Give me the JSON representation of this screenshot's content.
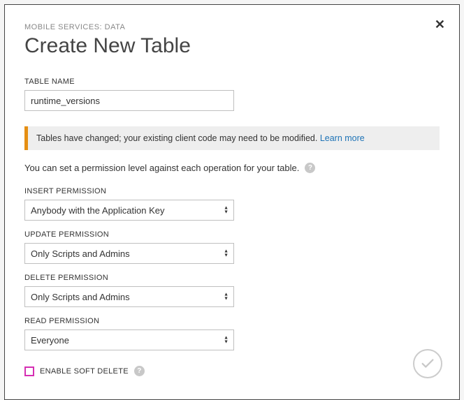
{
  "breadcrumb": "MOBILE SERVICES: DATA",
  "title": "Create New Table",
  "tableName": {
    "label": "TABLE NAME",
    "value": "runtime_versions"
  },
  "infoBar": {
    "text": "Tables have changed; your existing client code may need to be modified. ",
    "linkText": "Learn more"
  },
  "permissionDesc": "You can set a permission level against each operation for your table.",
  "permissions": {
    "insert": {
      "label": "INSERT PERMISSION",
      "value": "Anybody with the Application Key"
    },
    "update": {
      "label": "UPDATE PERMISSION",
      "value": "Only Scripts and Admins"
    },
    "delete": {
      "label": "DELETE PERMISSION",
      "value": "Only Scripts and Admins"
    },
    "read": {
      "label": "READ PERMISSION",
      "value": "Everyone"
    }
  },
  "softDelete": {
    "label": "ENABLE SOFT DELETE"
  }
}
